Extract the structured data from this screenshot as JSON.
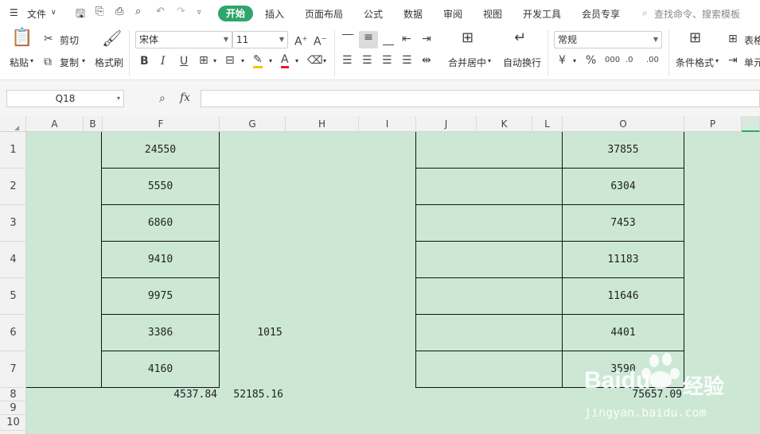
{
  "menubar": {
    "file_label": "文件",
    "tabs": [
      "开始",
      "插入",
      "页面布局",
      "公式",
      "数据",
      "审阅",
      "视图",
      "开发工具",
      "会员专享"
    ],
    "search_placeholder": "查找命令、搜索模板"
  },
  "ribbon": {
    "paste_label": "粘贴",
    "cut_label": "剪切",
    "copy_label": "复制",
    "format_painter_label": "格式刷",
    "font_name": "宋体",
    "font_size": "11",
    "merge_label": "合并居中",
    "wrap_label": "自动换行",
    "number_format": "常规",
    "cond_format_label": "条件格式",
    "table_style_label": "表格",
    "cell_label": "单元"
  },
  "formula_bar": {
    "name_box": "Q18",
    "fx_label": "fx",
    "formula": ""
  },
  "columns": [
    "A",
    "B",
    "F",
    "G",
    "H",
    "I",
    "J",
    "K",
    "L",
    "O",
    "P"
  ],
  "rows": [
    "1",
    "2",
    "3",
    "4",
    "5",
    "6",
    "7",
    "8",
    "9",
    "10"
  ],
  "cells": {
    "F": [
      "24550",
      "5550",
      "6860",
      "9410",
      "9975",
      "3386",
      "4160"
    ],
    "O": [
      "37855",
      "6304",
      "7453",
      "11183",
      "11646",
      "4401",
      "3590"
    ],
    "G6": "1015",
    "F8": "4537.84",
    "G8": "52185.16",
    "O8": "75657.09"
  },
  "watermark": {
    "brand": "Baidu",
    "cn": "经验",
    "url": "jingyan.baidu.com"
  }
}
